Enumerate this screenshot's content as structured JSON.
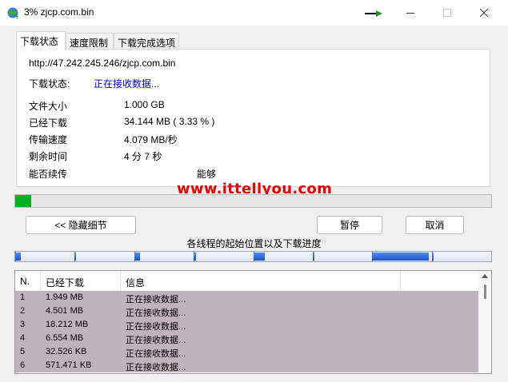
{
  "window": {
    "title": "3% zjcp.com.bin"
  },
  "tabs": [
    {
      "label": "下载状态"
    },
    {
      "label": "速度限制"
    },
    {
      "label": "下载完成选项"
    }
  ],
  "status": {
    "url": "http://47.242.245.246/zjcp.com.bin",
    "state_label": "下载状态:",
    "state_value": "正在接收数据...",
    "rows": [
      {
        "label": "文件大小",
        "value": "1.000  GB"
      },
      {
        "label": "已经下载",
        "value": "34.144  MB  ( 3.33 % )"
      },
      {
        "label": "传输速度",
        "value": "4.079  MB/秒"
      },
      {
        "label": "剩余时间",
        "value": "4 分 7 秒"
      },
      {
        "label": "能否续传",
        "value": "能够"
      }
    ]
  },
  "watermark": "www.ittellyou.com",
  "progress": {
    "percent": 3.33,
    "color": "#06b025"
  },
  "buttons": {
    "hide_details": "<< 隐藏细节",
    "pause": "暂停",
    "cancel": "取消"
  },
  "threads": {
    "label": "各线程的起始位置以及下载进度",
    "starts": [
      0,
      0.125,
      0.25,
      0.375,
      0.5,
      0.625,
      0.75,
      0.875
    ],
    "progress": [
      0.002,
      0.0005,
      0.002,
      0.0008,
      0.004,
      0.0005,
      0.02,
      0.0005
    ]
  },
  "list": {
    "headers": [
      "N.",
      "已经下载",
      "信息"
    ],
    "rows": [
      [
        "1",
        "1.949  MB",
        "正在接收数据..."
      ],
      [
        "2",
        "4.501  MB",
        "正在接收数据..."
      ],
      [
        "3",
        "18.212  MB",
        "正在接收数据..."
      ],
      [
        "4",
        "6.554  MB",
        "正在接收数据..."
      ],
      [
        "5",
        "32.526  KB",
        "正在接收数据..."
      ],
      [
        "6",
        "571.471  KB",
        "正在接收数据..."
      ]
    ]
  }
}
